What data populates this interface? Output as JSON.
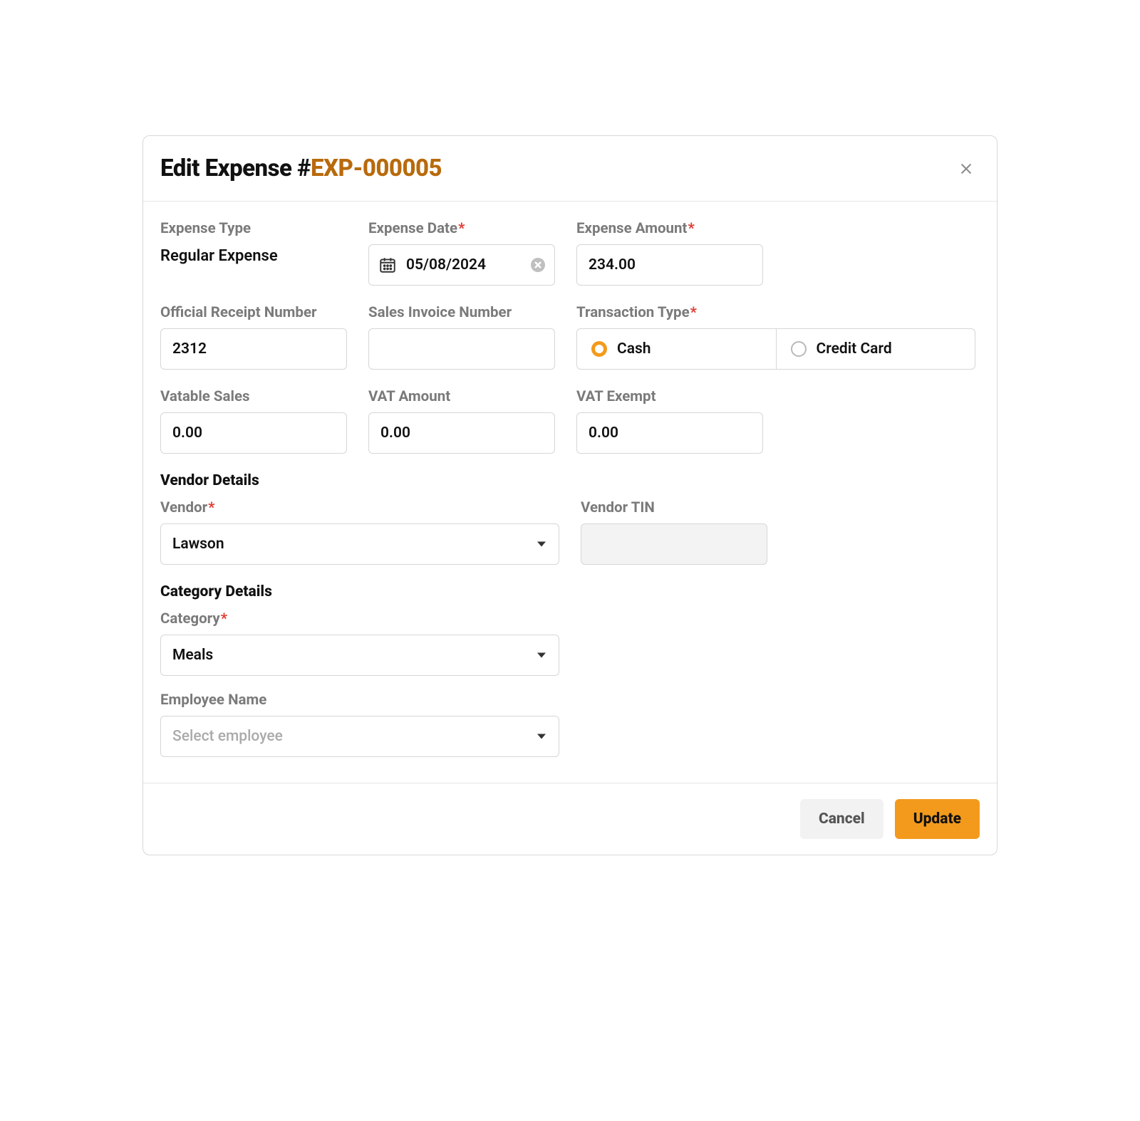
{
  "header": {
    "title_prefix": "Edit Expense #",
    "expense_id": "EXP-000005",
    "close_icon": "close-icon"
  },
  "fields": {
    "expense_type": {
      "label": "Expense Type",
      "value": "Regular Expense"
    },
    "expense_date": {
      "label": "Expense Date",
      "value": "05/08/2024",
      "required": true
    },
    "expense_amount": {
      "label": "Expense Amount",
      "value": "234.00",
      "required": true
    },
    "official_receipt": {
      "label": "Official Receipt Number",
      "value": "2312"
    },
    "sales_invoice": {
      "label": "Sales Invoice Number",
      "value": ""
    },
    "transaction_type": {
      "label": "Transaction Type",
      "required": true,
      "options": [
        "Cash",
        "Credit Card"
      ],
      "selected": "Cash"
    },
    "vatable_sales": {
      "label": "Vatable Sales",
      "value": "0.00"
    },
    "vat_amount": {
      "label": "VAT Amount",
      "value": "0.00"
    },
    "vat_exempt": {
      "label": "VAT Exempt",
      "value": "0.00"
    }
  },
  "sections": {
    "vendor_details": "Vendor Details",
    "category_details": "Category Details"
  },
  "vendor": {
    "label": "Vendor",
    "required": true,
    "value": "Lawson",
    "tin_label": "Vendor TIN",
    "tin_value": ""
  },
  "category": {
    "label": "Category",
    "required": true,
    "value": "Meals"
  },
  "employee": {
    "label": "Employee Name",
    "placeholder": "Select employee",
    "value": ""
  },
  "footer": {
    "cancel": "Cancel",
    "update": "Update"
  },
  "required_mark": "*"
}
